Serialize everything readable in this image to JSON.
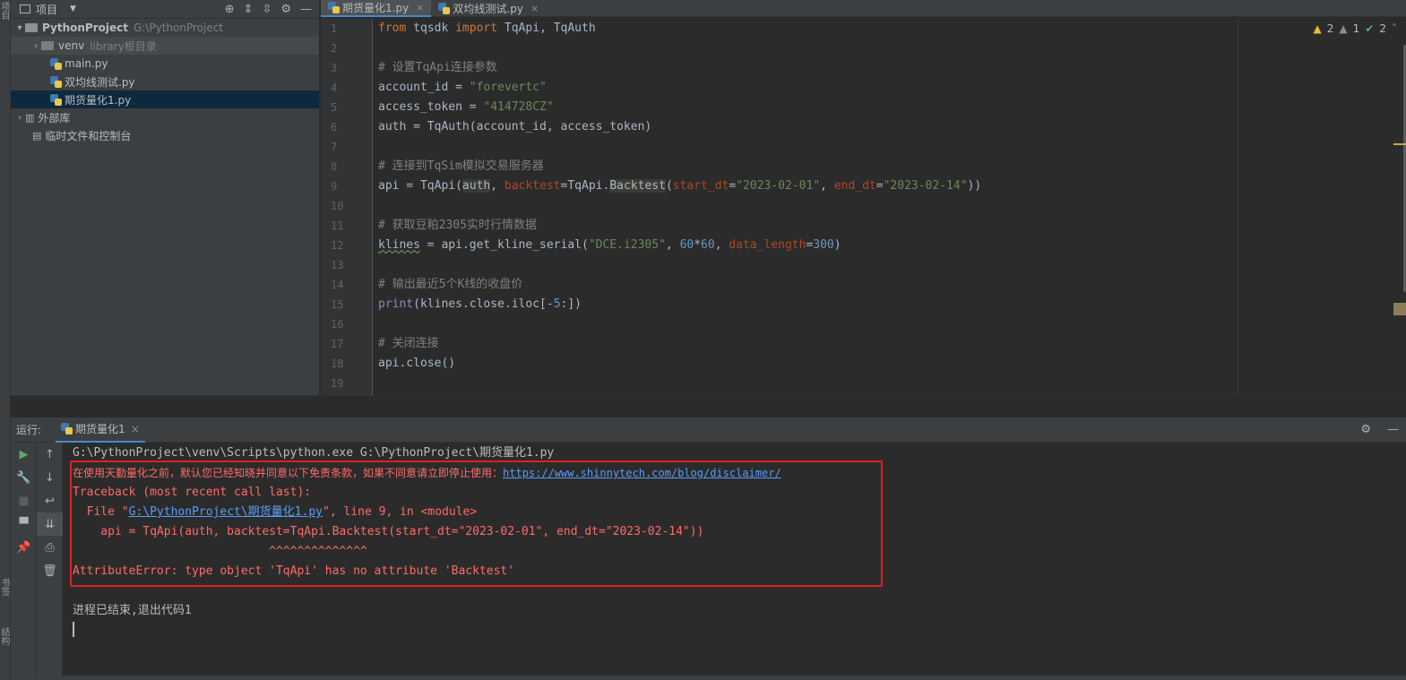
{
  "sidebar_strip": {
    "top_label": "项目",
    "mid_label": "书签",
    "bot_label": "结构"
  },
  "project_panel": {
    "title": "项目",
    "tree": [
      {
        "label": "PythonProject",
        "hint": "G:\\PythonProject",
        "kind": "root"
      },
      {
        "label": "venv",
        "hint": "library根目录",
        "kind": "folder"
      },
      {
        "label": "main.py",
        "kind": "py"
      },
      {
        "label": "双均线测试.py",
        "kind": "py"
      },
      {
        "label": "期货量化1.py",
        "kind": "py",
        "selected": true
      },
      {
        "label": "外部库",
        "kind": "lib"
      },
      {
        "label": "临时文件和控制台",
        "kind": "scratch"
      }
    ]
  },
  "editor": {
    "tabs": [
      {
        "label": "期货量化1.py",
        "active": true
      },
      {
        "label": "双均线测试.py"
      }
    ],
    "inspections": {
      "warnings": "2",
      "weak": "1",
      "ok": "2"
    },
    "line_numbers": [
      "1",
      "2",
      "3",
      "4",
      "5",
      "6",
      "7",
      "8",
      "9",
      "10",
      "11",
      "12",
      "13",
      "14",
      "15",
      "16",
      "17",
      "18",
      "19"
    ],
    "code": {
      "l1": [
        "from",
        " tqsdk ",
        "import",
        " TqApi, TqAuth"
      ],
      "l3": "# 设置TqApi连接参数",
      "l4": [
        "account_id = ",
        "\"forevertc\""
      ],
      "l5": [
        "access_token = ",
        "\"414728CZ\""
      ],
      "l6": "auth = TqAuth(account_id, access_token)",
      "l8": "# 连接到TqSim模拟交易服务器",
      "l9": [
        "api = TqApi(",
        "auth",
        ", ",
        "backtest",
        "=TqApi.",
        "Backtest",
        "(",
        "start_dt",
        "=",
        "\"2023-02-01\"",
        ", ",
        "end_dt",
        "=",
        "\"2023-02-14\"",
        "))"
      ],
      "l11": "# 获取豆粕2305实时行情数据",
      "l12": [
        "klines",
        " = api.get_kline_serial(",
        "\"DCE.i2305\"",
        ", ",
        "60",
        "*",
        "60",
        ", ",
        "data_length",
        "=",
        "300",
        ")"
      ],
      "l14": "# 输出最近5个K线的收盘价",
      "l15": [
        "print",
        "(klines.close.iloc[-",
        "5",
        ":])"
      ],
      "l17": "# 关闭连接",
      "l18": "api.close()"
    }
  },
  "run_panel": {
    "label": "运行:",
    "tab": "期货量化1",
    "output": {
      "cmd": "G:\\PythonProject\\venv\\Scripts\\python.exe G:\\PythonProject\\期货量化1.py",
      "disclaimer_text": "在使用天勤量化之前，默认您已经知晓并同意以下免责条款，如果不同意请立即停止使用：",
      "disclaimer_link": "https://www.shinnytech.com/blog/disclaimer/",
      "traceback": "Traceback (most recent call last):",
      "file_pre": "  File \"",
      "file_link": "G:\\PythonProject\\期货量化1.py",
      "file_post": "\", line 9, in <module>",
      "code_line": "    api = TqApi(auth, backtest=TqApi.Backtest(start_dt=\"2023-02-01\", end_dt=\"2023-02-14\"))",
      "carets": "                            ^^^^^^^^^^^^^^",
      "error": "AttributeError: type object 'TqApi' has no attribute 'Backtest'",
      "exit": "进程已结束,退出代码1"
    }
  }
}
